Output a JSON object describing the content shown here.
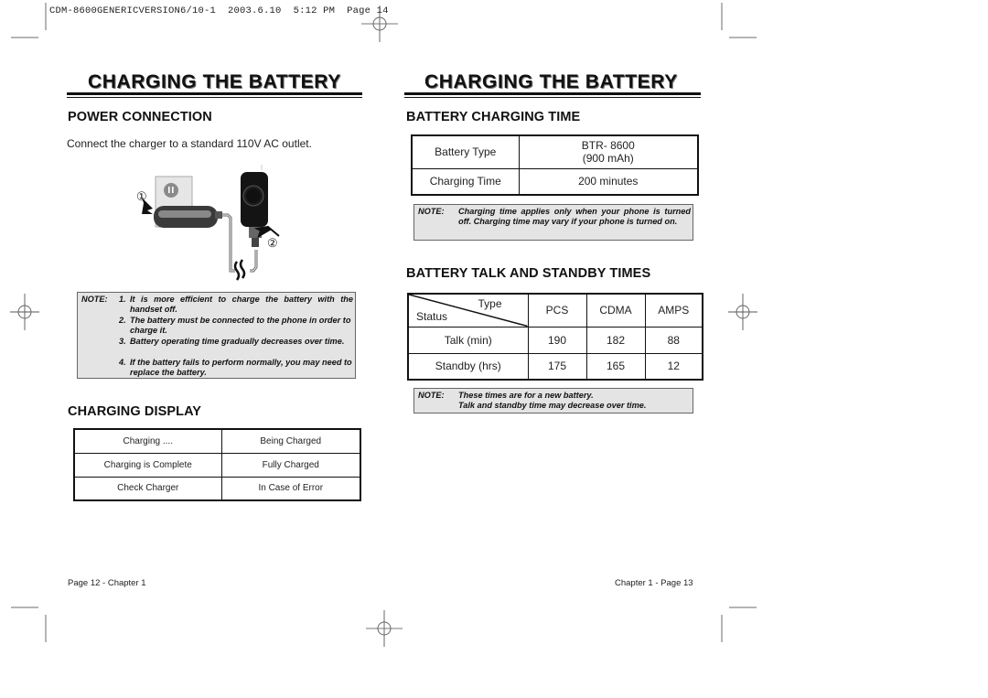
{
  "slug": {
    "file": "CDM-8600GENERICVERSION6/10-1",
    "date": "2003.6.10",
    "time": "5:12 PM",
    "page": "Page 14"
  },
  "left_page": {
    "title": "CHARGING THE BATTERY",
    "power_connection": {
      "heading": "POWER CONNECTION",
      "instruction": "Connect the charger to a standard 110V AC outlet.",
      "callouts": [
        "①",
        "②"
      ],
      "note": {
        "label": "NOTE:",
        "items": [
          {
            "num": "1.",
            "text": "It is more efficient to charge the battery with the handset off."
          },
          {
            "num": "2.",
            "text": "The battery must be connected to the phone in order to charge it."
          },
          {
            "num": "3.",
            "text": "Battery operating time gradually decreases over time."
          },
          {
            "num": "4.",
            "text": "If the battery fails to perform normally, you may need to replace the battery."
          }
        ]
      }
    },
    "charging_display": {
      "heading": "CHARGING DISPLAY",
      "rows": [
        {
          "display": "Charging ....",
          "meaning": "Being Charged"
        },
        {
          "display": "Charging is Complete",
          "meaning": "Fully Charged"
        },
        {
          "display": "Check Charger",
          "meaning": "In Case of Error"
        }
      ]
    },
    "footer": "Page 12 - Chapter 1"
  },
  "right_page": {
    "title": "CHARGING THE BATTERY",
    "charging_time": {
      "heading": "BATTERY CHARGING TIME",
      "rows": [
        {
          "label": "Battery Type",
          "value_line1": "BTR- 8600",
          "value_line2": "(900 mAh)"
        },
        {
          "label": "Charging Time",
          "value_line1": "200 minutes"
        }
      ],
      "note": {
        "label": "NOTE:",
        "text": "Charging time applies only when your phone is turned off. Charging time may vary if your phone is turned on."
      }
    },
    "talk_standby": {
      "heading": "BATTERY TALK AND STANDBY TIMES",
      "corner_type": "Type",
      "corner_status": "Status",
      "columns": [
        "PCS",
        "CDMA",
        "AMPS"
      ],
      "rows": [
        {
          "label": "Talk (min)",
          "values": [
            "190",
            "182",
            "88"
          ]
        },
        {
          "label": "Standby (hrs)",
          "values": [
            "175",
            "165",
            "12"
          ]
        }
      ],
      "note": {
        "label": "NOTE:",
        "lines": [
          "These times are for a new battery.",
          "Talk and standby time may decrease over time."
        ]
      }
    },
    "footer": "Chapter 1 - Page 13"
  }
}
